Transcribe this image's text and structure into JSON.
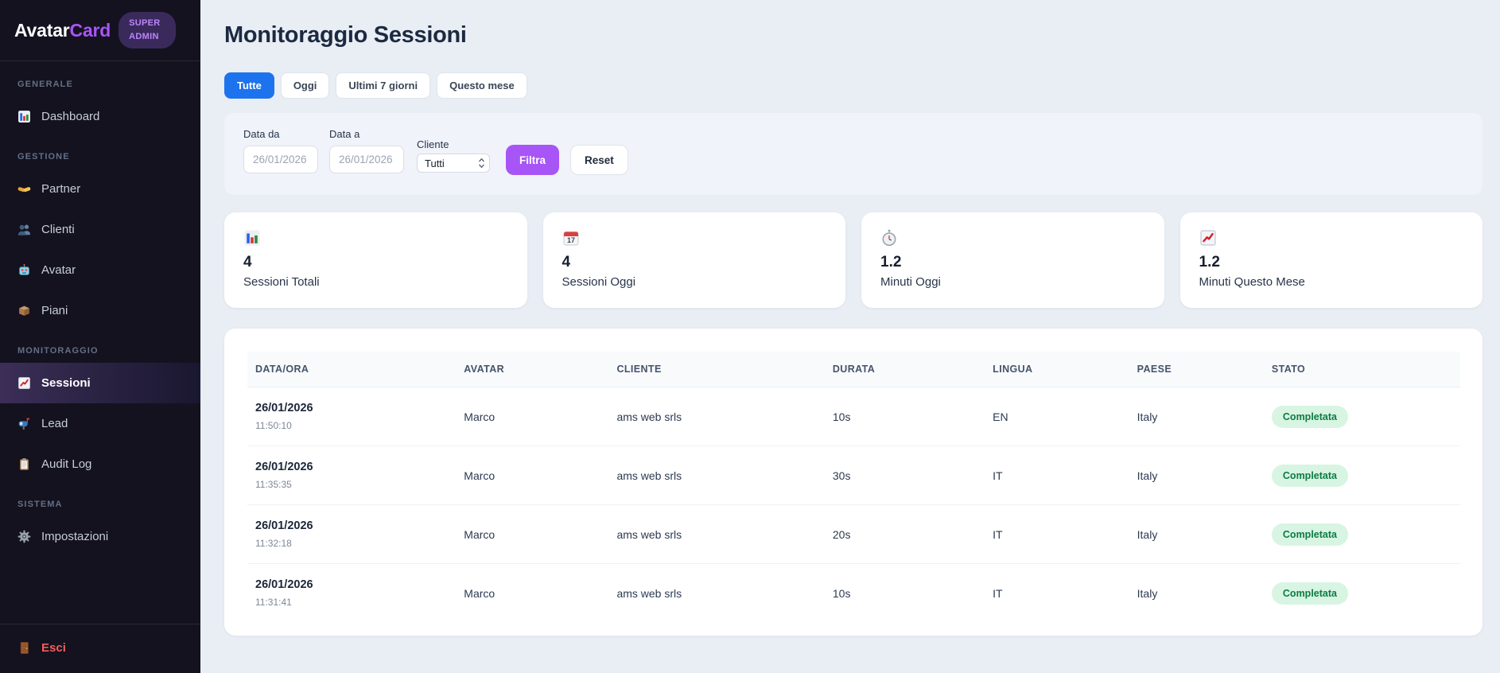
{
  "sidebar": {
    "logo": {
      "brand_primary": "Avatar",
      "brand_accent": "Card"
    },
    "badge": "SUPER ADMIN",
    "sections": [
      {
        "label": "GENERALE",
        "items": [
          {
            "icon": "bar-chart-icon",
            "label": "Dashboard"
          }
        ]
      },
      {
        "label": "GESTIONE",
        "items": [
          {
            "icon": "handshake-icon",
            "label": "Partner"
          },
          {
            "icon": "users-icon",
            "label": "Clienti"
          },
          {
            "icon": "robot-icon",
            "label": "Avatar"
          },
          {
            "icon": "package-icon",
            "label": "Piani"
          }
        ]
      },
      {
        "label": "MONITORAGGIO",
        "items": [
          {
            "icon": "chart-up-icon",
            "label": "Sessioni",
            "active": true
          },
          {
            "icon": "mailbox-icon",
            "label": "Lead"
          },
          {
            "icon": "clipboard-icon",
            "label": "Audit Log"
          }
        ]
      },
      {
        "label": "SISTEMA",
        "items": [
          {
            "icon": "gear-icon",
            "label": "Impostazioni"
          }
        ]
      }
    ],
    "logout": {
      "icon": "door-icon",
      "label": "Esci"
    }
  },
  "header": {
    "title": "Monitoraggio Sessioni"
  },
  "filters": {
    "tabs": [
      {
        "label": "Tutte",
        "active": true
      },
      {
        "label": "Oggi",
        "active": false
      },
      {
        "label": "Ultimi 7 giorni",
        "active": false
      },
      {
        "label": "Questo mese",
        "active": false
      }
    ],
    "date_from": {
      "label": "Data da",
      "value": "26/01/2026"
    },
    "date_to": {
      "label": "Data a",
      "value": "26/01/2026"
    },
    "client": {
      "label": "Cliente",
      "selected": "Tutti"
    },
    "filter_button": "Filtra",
    "reset_button": "Reset"
  },
  "stats": [
    {
      "icon": "bar-chart-icon",
      "value": "4",
      "label": "Sessioni Totali"
    },
    {
      "icon": "calendar-icon",
      "calendar_day": "17",
      "value": "4",
      "label": "Sessioni Oggi"
    },
    {
      "icon": "stopwatch-icon",
      "value": "1.2",
      "label": "Minuti Oggi"
    },
    {
      "icon": "chart-up-icon",
      "value": "1.2",
      "label": "Minuti Questo Mese"
    }
  ],
  "table": {
    "columns": [
      "DATA/ORA",
      "AVATAR",
      "CLIENTE",
      "DURATA",
      "LINGUA",
      "PAESE",
      "STATO"
    ],
    "rows": [
      {
        "date": "26/01/2026",
        "time": "11:50:10",
        "avatar": "Marco",
        "cliente": "ams web srls",
        "durata": "10s",
        "lingua": "EN",
        "paese": "Italy",
        "stato": "Completata"
      },
      {
        "date": "26/01/2026",
        "time": "11:35:35",
        "avatar": "Marco",
        "cliente": "ams web srls",
        "durata": "30s",
        "lingua": "IT",
        "paese": "Italy",
        "stato": "Completata"
      },
      {
        "date": "26/01/2026",
        "time": "11:32:18",
        "avatar": "Marco",
        "cliente": "ams web srls",
        "durata": "20s",
        "lingua": "IT",
        "paese": "Italy",
        "stato": "Completata"
      },
      {
        "date": "26/01/2026",
        "time": "11:31:41",
        "avatar": "Marco",
        "cliente": "ams web srls",
        "durata": "10s",
        "lingua": "IT",
        "paese": "Italy",
        "stato": "Completata"
      }
    ]
  },
  "colors": {
    "brand_accent_purple": "#a855f7",
    "active_tab_blue": "#1d73ee",
    "filter_button_purple": "#a855f7",
    "success_badge_bg": "#d7f5e2",
    "success_badge_text": "#0e7a45",
    "logout_red": "#f05e5e",
    "sidebar_bg": "#14121f",
    "page_bg": "#e9edf4"
  }
}
